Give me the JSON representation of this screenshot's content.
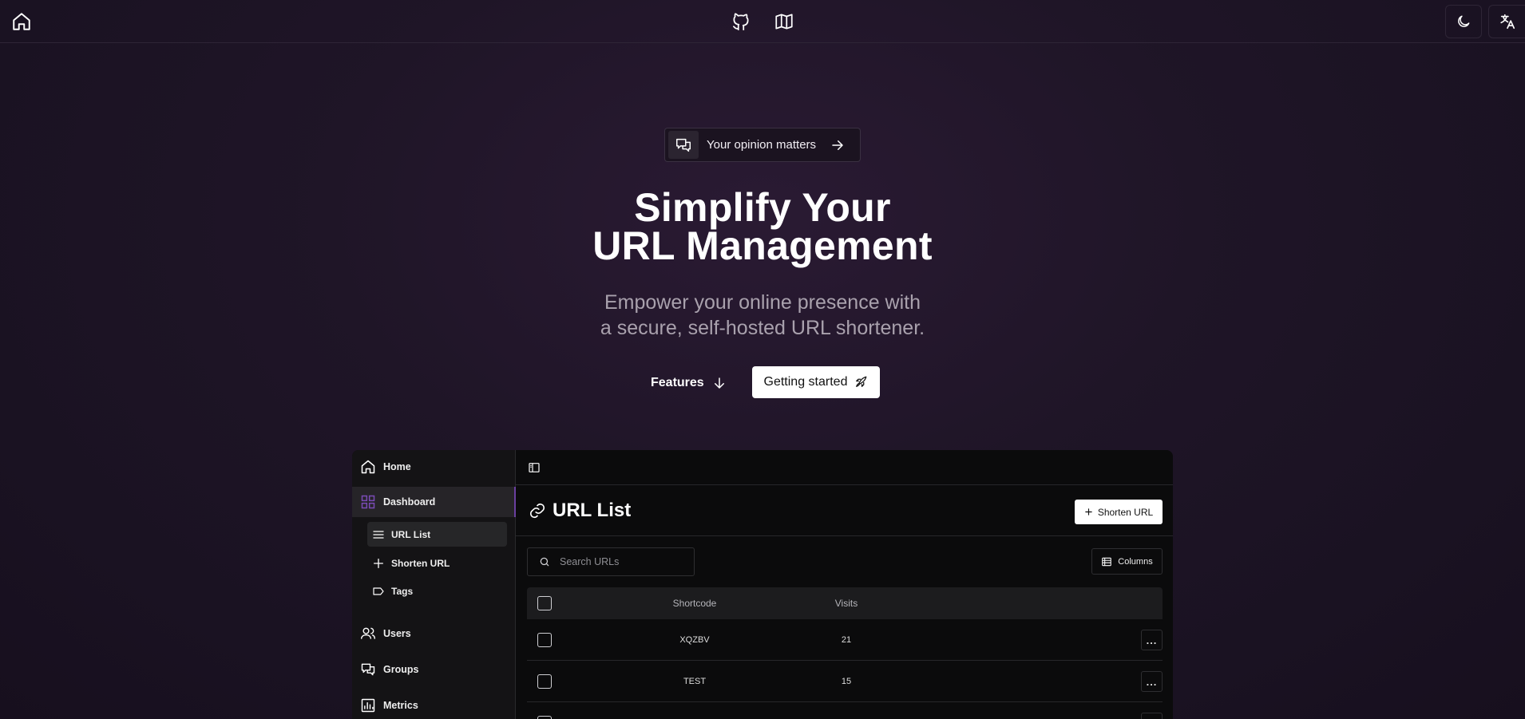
{
  "topnav": {
    "home_icon": "home-icon",
    "center_icons": [
      "github-icon",
      "docs-icon"
    ],
    "right_icons": [
      "theme-moon-icon",
      "language-icon"
    ]
  },
  "hero": {
    "pill_text": "Your opinion matters",
    "title_line1": "Simplify Your",
    "title_line2": "URL Management",
    "subtitle_line1": "Empower your online presence with",
    "subtitle_line2": "a secure, self-hosted URL shortener.",
    "features_label": "Features",
    "getting_started_label": "Getting started"
  },
  "preview": {
    "sidebar": {
      "home": "Home",
      "dashboard": "Dashboard",
      "sub_items": [
        "URL List",
        "Shorten URL",
        "Tags"
      ],
      "users": "Users",
      "groups": "Groups",
      "metrics": "Metrics"
    },
    "page_title": "URL List",
    "shorten_button": "Shorten URL",
    "search_placeholder": "Search URLs",
    "columns_button": "Columns",
    "table": {
      "headers": [
        "Shortcode",
        "Visits"
      ],
      "rows": [
        {
          "shortcode": "XQZBV",
          "visits": "21"
        },
        {
          "shortcode": "TEST",
          "visits": "15"
        }
      ],
      "row_menu": "..."
    }
  },
  "colors": {
    "background": "#1f1527",
    "accent": "#6a3fa0",
    "app_background": "#0b0b0c"
  }
}
